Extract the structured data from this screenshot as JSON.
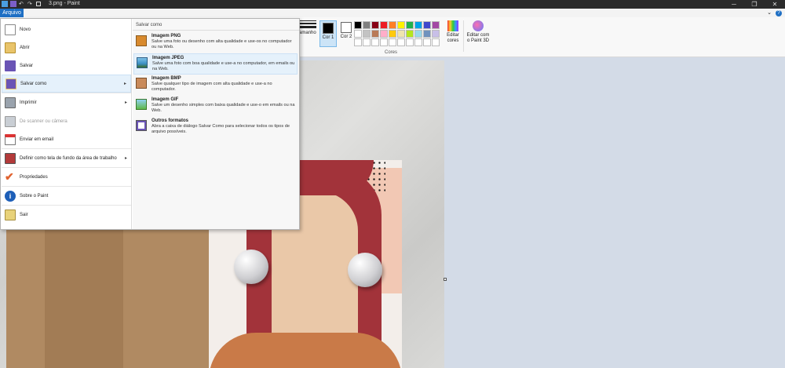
{
  "window": {
    "title": "3.png - Paint",
    "minimize": "─",
    "maximize": "❐",
    "close": "✕"
  },
  "ribbon": {
    "file_tab": "Arquivo",
    "help": "?",
    "size_label": "amanho",
    "cor1_label": "Cor 1",
    "cor2_label": "Cor 2",
    "colors_group_label": "Cores",
    "edit_colors_label": "Editar cores",
    "paint3d_label": "Editar com o Paint 3D",
    "palette": [
      "#000000",
      "#7f7f7f",
      "#880015",
      "#ed1c24",
      "#ff7f27",
      "#fff200",
      "#22b14c",
      "#00a2e8",
      "#3f48cc",
      "#a349a4",
      "#ffffff",
      "#c3c3c3",
      "#b97a57",
      "#ffaec9",
      "#ffc90e",
      "#efe4b0",
      "#b5e61d",
      "#99d9ea",
      "#7092be",
      "#c8bfe7",
      "#ffffff",
      "#ffffff",
      "#ffffff",
      "#ffffff",
      "#ffffff",
      "#ffffff",
      "#ffffff",
      "#ffffff",
      "#ffffff",
      "#ffffff"
    ]
  },
  "file_menu": {
    "items": [
      {
        "label": "Novo",
        "icon": "new-file-icon"
      },
      {
        "label": "Abrir",
        "icon": "open-folder-icon"
      },
      {
        "label": "Salvar",
        "icon": "save-icon"
      },
      {
        "label": "Salvar como",
        "icon": "save-as-icon",
        "arrow": "▸"
      },
      {
        "label": "Imprimir",
        "icon": "print-icon",
        "arrow": "▸"
      },
      {
        "label": "De scanner ou câmera",
        "icon": "scanner-icon"
      },
      {
        "label": "Enviar em email",
        "icon": "email-icon"
      },
      {
        "label": "Definir como tela de fundo da área de trabalho",
        "icon": "wallpaper-icon",
        "arrow": "▸"
      },
      {
        "label": "Propriedades",
        "icon": "properties-check-icon"
      },
      {
        "label": "Sobre o Paint",
        "icon": "info-icon"
      },
      {
        "label": "Sair",
        "icon": "exit-icon"
      }
    ],
    "submenu_heading": "Salvar como",
    "formats": [
      {
        "title": "Imagem PNG",
        "desc": "Salve uma foto ou desenho com alta qualidade e use-os no computador ou na Web."
      },
      {
        "title": "Imagem JPEG",
        "desc": "Salve uma foto com boa qualidade e use-a no computador, em emails ou na Web."
      },
      {
        "title": "Imagem BMP",
        "desc": "Salve qualquer tipo de imagem com alta qualidade e use-a no computador."
      },
      {
        "title": "Imagem GIF",
        "desc": "Salve um desenho simples com baixa qualidade e use-o em emails ou na Web."
      },
      {
        "title": "Outros formatos",
        "desc": "Abra a caixa de diálogo Salvar Como para selecionar todos os tipos de arquivo possíveis."
      }
    ]
  }
}
